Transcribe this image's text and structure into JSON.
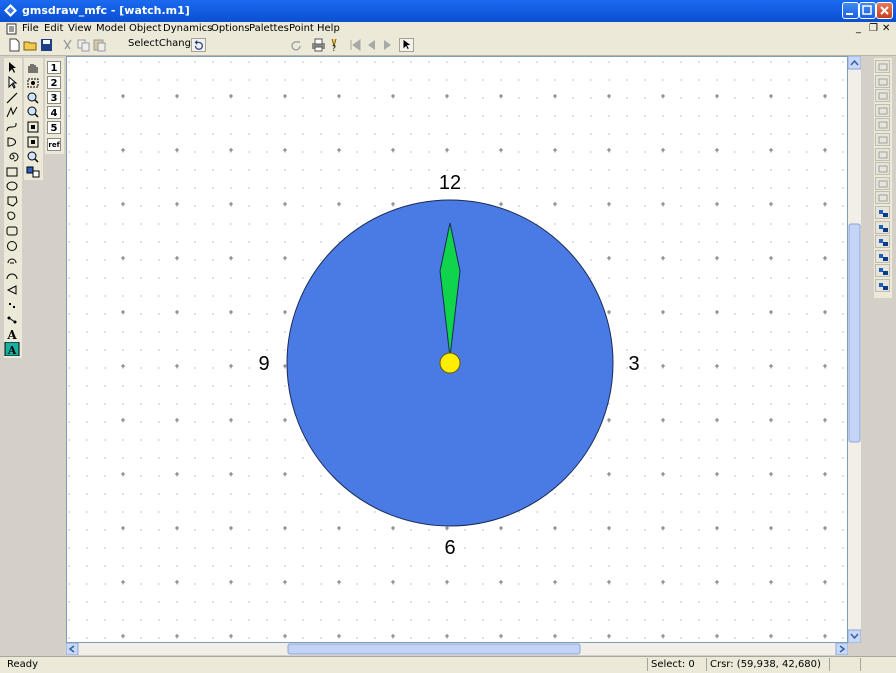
{
  "window": {
    "title": "gmsdraw_mfc - [watch.m1]"
  },
  "menubar": {
    "items": [
      {
        "key": "file",
        "label": "File"
      },
      {
        "key": "edit",
        "label": "Edit"
      },
      {
        "key": "view",
        "label": "View"
      },
      {
        "key": "model",
        "label": "Model"
      },
      {
        "key": "object",
        "label": "Object"
      },
      {
        "key": "dynamics",
        "label": "Dynamics"
      },
      {
        "key": "options",
        "label": "Options"
      },
      {
        "key": "palettes",
        "label": "Palettes"
      },
      {
        "key": "point",
        "label": "Point"
      },
      {
        "key": "help",
        "label": "Help"
      }
    ]
  },
  "toolbar": {
    "select_change_label": "SelectChange"
  },
  "layer_buttons": [
    "1",
    "2",
    "3",
    "4",
    "5",
    "ref"
  ],
  "clock": {
    "label_12": "12",
    "label_3": "3",
    "label_6": "6",
    "label_9": "9",
    "face_color": "#4a7ae4",
    "hand_color": "#0fd44c",
    "hub_color": "#ffee00"
  },
  "statusbar": {
    "ready": "Ready",
    "select": "Select: 0",
    "cursor": "Crsr: (59,938, 42,680)"
  },
  "colors": {
    "titlebar": "#0a4fd0",
    "menubar": "#ece9d8",
    "canvas_bg": "#ffffff"
  }
}
